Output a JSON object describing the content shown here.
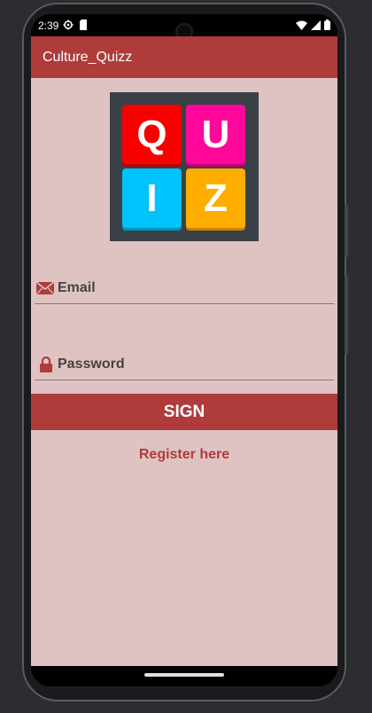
{
  "status_bar": {
    "time": "2:39",
    "icons": [
      "gear-icon",
      "sd-card-icon",
      "wifi-icon",
      "signal-icon",
      "battery-icon"
    ]
  },
  "app_bar": {
    "title": "Culture_Quizz"
  },
  "logo": {
    "letters": [
      "Q",
      "U",
      "I",
      "Z"
    ],
    "colors": [
      "#f60000",
      "#ff079a",
      "#00c3fb",
      "#ffae00"
    ],
    "background": "#3a4146"
  },
  "form": {
    "email_placeholder": "Email",
    "password_placeholder": "Password",
    "sign_label": "SIGN",
    "register_label": "Register here"
  },
  "colors": {
    "primary": "#b03b3b",
    "background": "#dfc3c3"
  }
}
